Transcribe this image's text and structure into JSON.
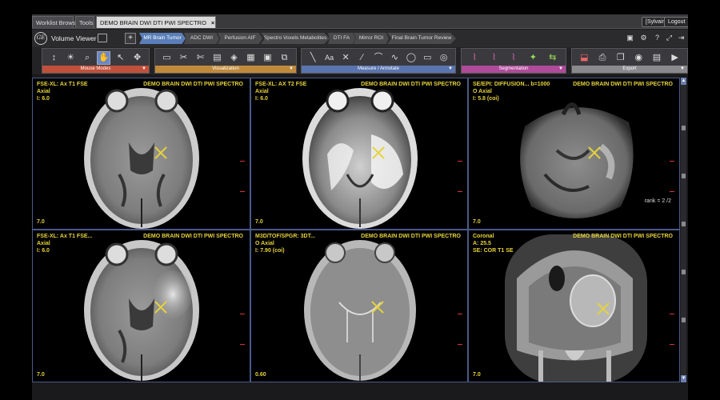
{
  "top_tabs": [
    {
      "label": "Worklist Browser"
    },
    {
      "label": "Tools"
    },
    {
      "label": "DEMO BRAIN DWI DTI PWI SPECTRO",
      "close": "×"
    }
  ],
  "user": {
    "label": "[Sylvain]"
  },
  "logout": {
    "label": "Logout"
  },
  "header": {
    "logo": "GE",
    "title": "Volume Viewer",
    "add": "+"
  },
  "protocol_tabs": [
    {
      "label": "MR Brain Tumor",
      "active": true
    },
    {
      "label": "ADC DWI"
    },
    {
      "label": "Perfusion AIF"
    },
    {
      "label": "Spectro Voxels Metabolites"
    },
    {
      "label": "DTI FA"
    },
    {
      "label": "Mirror ROI"
    },
    {
      "label": "Final Brain Tumor Review"
    }
  ],
  "header_icons": [
    "monitor-icon",
    "gear-icon",
    "help-icon",
    "fullscreen-icon",
    "exit-icon"
  ],
  "toolbar": {
    "groups": [
      {
        "label": "Mouse Modes",
        "color": "#c0503c",
        "icons": [
          "↕",
          "☀",
          "🔍",
          "✋",
          "↖",
          "✥"
        ]
      },
      {
        "label": "Visualization",
        "color": "#c08a3c",
        "icons": [
          "▭",
          "✂",
          "✂",
          "▤",
          "◈",
          "▦",
          "▣",
          "⧉"
        ]
      },
      {
        "label": "Measure / Annotate",
        "color": "#5a74b0",
        "icons": [
          "╲",
          "Aa",
          "✕",
          "∕",
          "⌒",
          "∿",
          "◯",
          "▭",
          "◎"
        ]
      },
      {
        "label": "Segmentation",
        "color": "#b04a9a",
        "icons": [
          "⌇",
          "⌇",
          "⌇",
          "✦",
          "⇆"
        ]
      },
      {
        "label": "Export",
        "color": "#8a8a8d",
        "icons": [
          "⬓",
          "⎙",
          "❐",
          "◉",
          "▤",
          "🏃"
        ]
      }
    ]
  },
  "viewports": [
    {
      "series": "FSE-XL: Ax T1 FSE",
      "study": "DEMO BRAIN DWI DTI PWI SPECTRO",
      "plane": "Axial",
      "index": "I: 6.0",
      "thickness": "7.0"
    },
    {
      "series": "FSE-XL: AX T2 FSE",
      "study": "DEMO BRAIN DWI DTI PWI SPECTRO",
      "plane": "Axial",
      "index": "I: 6.0",
      "thickness": "7.0"
    },
    {
      "series": "SE/EPI: DIFFUSION... b=1000",
      "study": "DEMO BRAIN DWI DTI PWI SPECTRO",
      "plane": "O Axial",
      "index": "I: 5.8 (coi)",
      "thickness": "7.0",
      "rank": "rank = 2 /2"
    },
    {
      "series": "FSE-XL: Ax T1 FSE...",
      "study": "DEMO BRAIN DWI DTI PWI SPECTRO",
      "plane": "Axial",
      "index": "I: 6.0",
      "thickness": "7.0"
    },
    {
      "series": "M3D/TOF/SPGR: 3DT...",
      "study": "DEMO BRAIN DWI DTI PWI SPECTRO",
      "plane": "O Axial",
      "index": "I: 7.90 (coi)",
      "thickness": "0.60"
    },
    {
      "series": "Coronal",
      "study": "DEMO BRAIN DWI DTI PWI SPECTRO",
      "plane": "A: 25.5",
      "index": "SE: COR T1 SE",
      "thickness": "7.0"
    }
  ],
  "colors": {
    "overlay_text": "#e6d23c",
    "viewport_border": "#4a5a8a",
    "active_tab": "#5a7fb8"
  }
}
